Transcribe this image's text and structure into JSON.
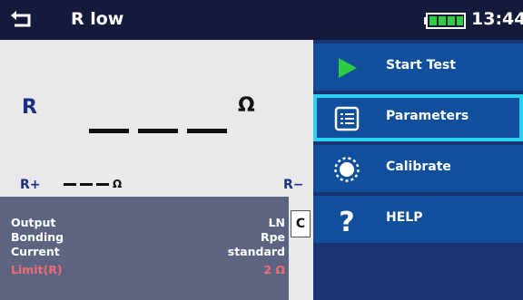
{
  "header": {
    "title": "R low",
    "clock": "13:44",
    "icons": {
      "back": "back-arrow-icon",
      "battery": "battery-full-icon"
    },
    "colors": {
      "background": "#151a3a",
      "battery": "#2ecc40"
    }
  },
  "result": {
    "r_label": "R",
    "r_value": "___",
    "r_unit": "Ω",
    "rplus_label": "R+",
    "rplus_value": "___",
    "rplus_unit": "Ω",
    "rminus_label": "R−"
  },
  "parameters": {
    "rows": [
      {
        "name": "Output",
        "value": "LN"
      },
      {
        "name": "Bonding",
        "value": "Rpe"
      },
      {
        "name": "Current",
        "value": "standard"
      },
      {
        "name": "Limit(R)",
        "value": "2 Ω"
      }
    ],
    "colors": {
      "panel": "#5d6482",
      "limit": "#f36b71"
    }
  },
  "connector": {
    "label": "C"
  },
  "menu": {
    "items": [
      {
        "label": "Start Test",
        "icon": "play-icon"
      },
      {
        "label": "Parameters",
        "icon": "list-icon",
        "selected": true
      },
      {
        "label": "Calibrate",
        "icon": "calibrate-icon"
      },
      {
        "label": "HELP",
        "icon": "help-icon"
      }
    ],
    "colors": {
      "item": "#0f4f9c",
      "background": "#1a3372",
      "selected_border": "#29d2f0",
      "play": "#2ecc40"
    }
  }
}
